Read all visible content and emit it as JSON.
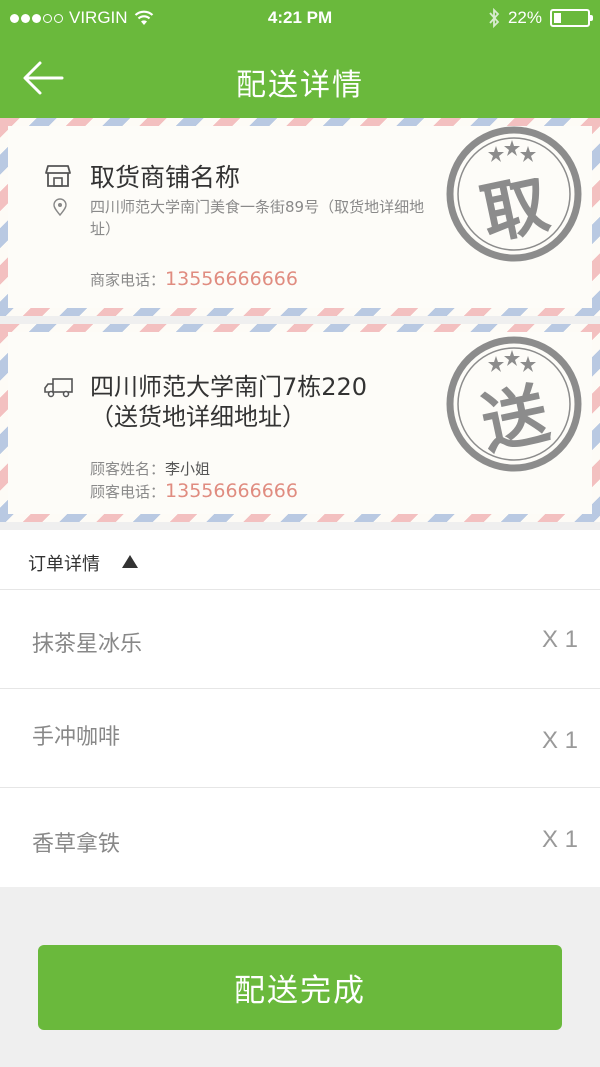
{
  "status_bar": {
    "carrier": "VIRGIN",
    "time": "4:21 PM",
    "battery_percent": "22%",
    "battery_level": 0.22
  },
  "nav": {
    "title": "配送详情"
  },
  "pickup": {
    "shop_name": "取货商铺名称",
    "address": "四川师范大学南门美食一条街89号（取货地详细地址）",
    "phone_label": "商家电话：",
    "phone": "13556666666",
    "stamp_char": "取"
  },
  "delivery": {
    "address_line1": "四川师范大学南门7栋220",
    "address_line2": "（送货地详细地址）",
    "name_label": "顾客姓名：",
    "name": "李小姐",
    "phone_label": "顾客电话：",
    "phone": "13556666666",
    "stamp_char": "送"
  },
  "order": {
    "header": "订单详情",
    "items": [
      {
        "name": "抹茶星冰乐",
        "qty": "X 1"
      },
      {
        "name": "手冲咖啡",
        "qty": "X 1"
      },
      {
        "name": "香草拿铁",
        "qty": "X 1"
      }
    ]
  },
  "actions": {
    "complete_label": "配送完成"
  },
  "colors": {
    "brand_green": "#6ab93c",
    "phone_red": "#e08c80",
    "stamp_gray": "#8c8c8c"
  }
}
